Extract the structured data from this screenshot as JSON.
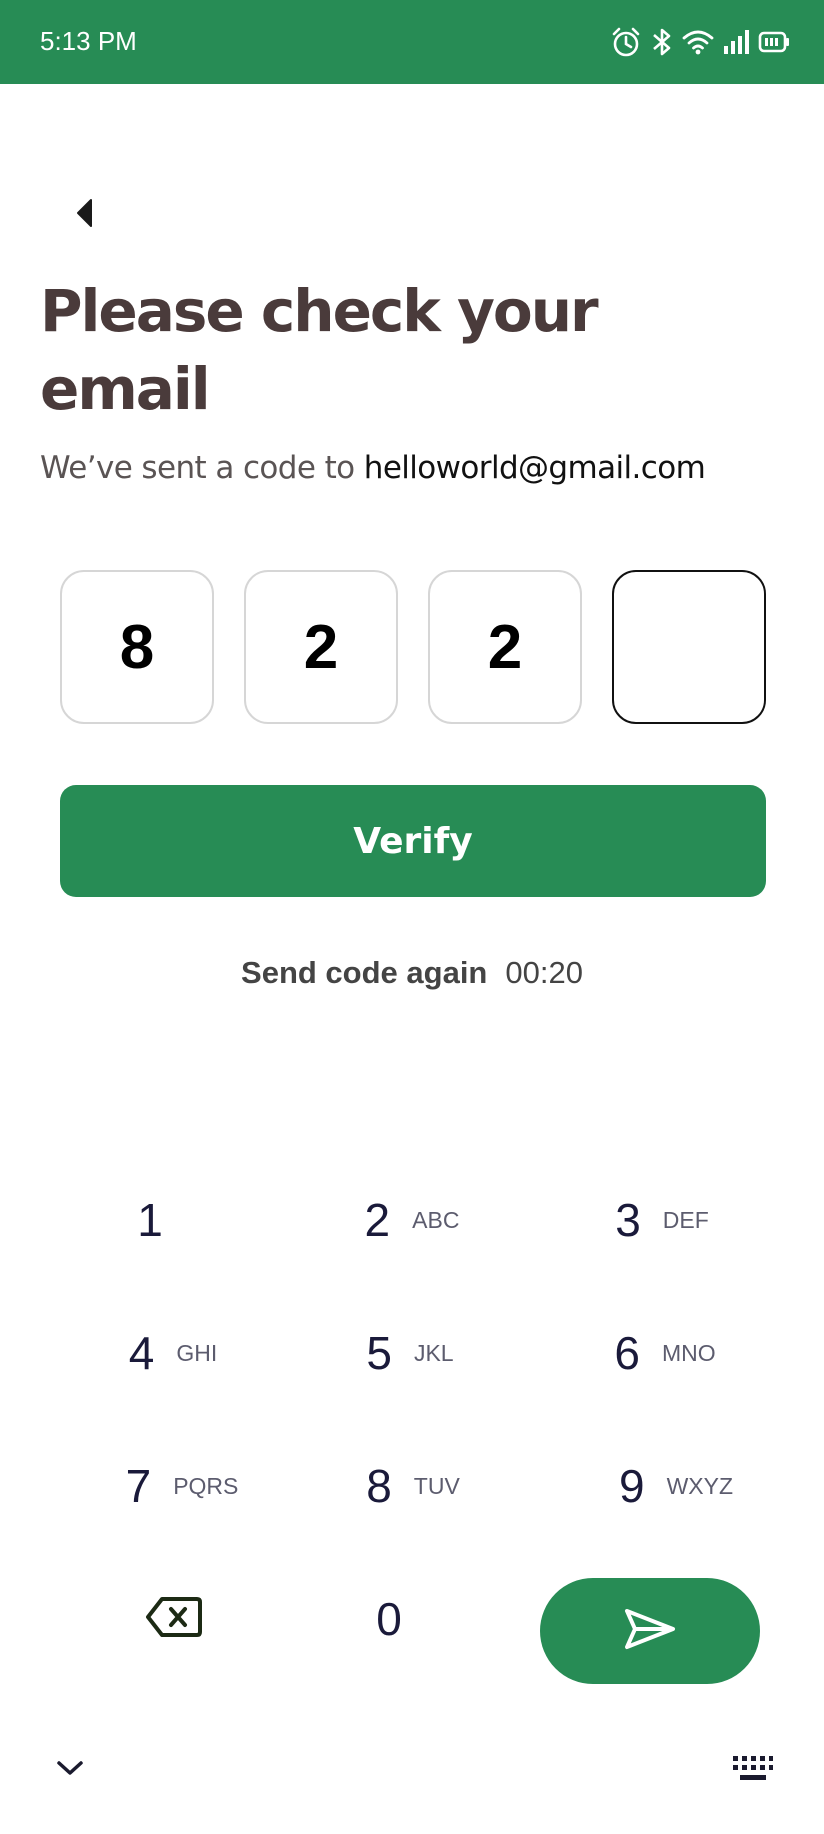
{
  "status_bar": {
    "time": "5:13 PM",
    "icons": [
      "alarm-icon",
      "bluetooth-icon",
      "wifi-icon",
      "signal-icon",
      "battery-icon"
    ],
    "background": "#278c55"
  },
  "header": {
    "back_icon": "back-arrow-icon",
    "title": "Please check your email",
    "subtitle_prefix": "We’ve sent a code to ",
    "email": "helloworld@gmail.com"
  },
  "otp": {
    "digits": [
      "8",
      "2",
      "2",
      ""
    ],
    "active_index": 3
  },
  "verify_button": {
    "label": "Verify",
    "color": "#278c55"
  },
  "resend": {
    "label": "Send code again",
    "timer": "00:20"
  },
  "keypad": {
    "keys": [
      {
        "digit": "1",
        "letters": ""
      },
      {
        "digit": "2",
        "letters": "ABC"
      },
      {
        "digit": "3",
        "letters": "DEF"
      },
      {
        "digit": "4",
        "letters": "GHI"
      },
      {
        "digit": "5",
        "letters": "JKL"
      },
      {
        "digit": "6",
        "letters": "MNO"
      },
      {
        "digit": "7",
        "letters": "PQRS"
      },
      {
        "digit": "8",
        "letters": "TUV"
      },
      {
        "digit": "9",
        "letters": "WXYZ"
      },
      {
        "digit": "0",
        "letters": ""
      }
    ],
    "backspace_icon": "backspace-icon",
    "send_icon": "send-icon"
  },
  "bottom_bar": {
    "collapse_icon": "chevron-down-icon",
    "keyboard_icon": "keyboard-icon"
  }
}
